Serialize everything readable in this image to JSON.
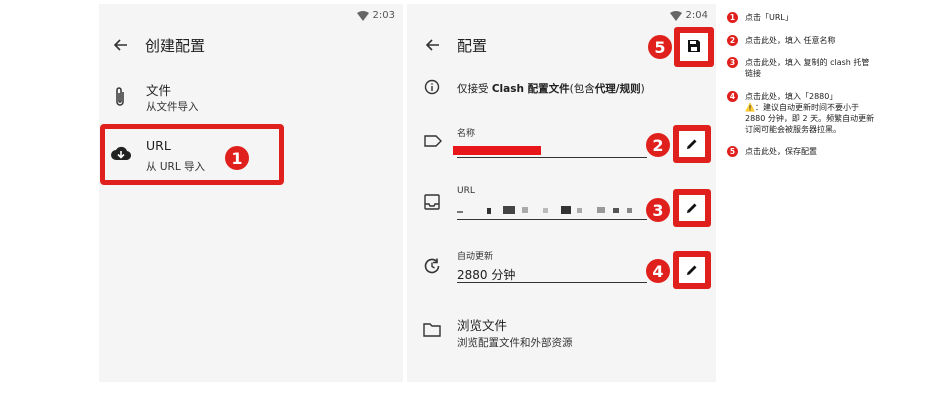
{
  "screen_left": {
    "status_time": "2:03",
    "title": "创建配置",
    "items": [
      {
        "title": "文件",
        "subtitle": "从文件导入"
      },
      {
        "title": "URL",
        "subtitle": "从 URL 导入"
      }
    ],
    "badge": "1"
  },
  "screen_right": {
    "status_time": "2:04",
    "title": "配置",
    "info_prefix": "仅接受 ",
    "info_bold1": "Clash 配置文件",
    "info_mid": "(包含",
    "info_bold2": "代理/规则",
    "info_suffix": ")",
    "fields": [
      {
        "label": "名称",
        "value": ""
      },
      {
        "label": "URL",
        "value": ""
      },
      {
        "label": "自动更新",
        "value": "2880 分钟"
      }
    ],
    "browse": {
      "title": "浏览文件",
      "subtitle": "浏览配置文件和外部资源"
    },
    "badges": [
      "2",
      "3",
      "4",
      "5"
    ]
  },
  "notes": [
    {
      "num": "1",
      "text": "点击「URL」"
    },
    {
      "num": "2",
      "text": "点击此处，填入 任意名称"
    },
    {
      "num": "3",
      "text": "点击此处，填入 复制的 clash 托管\n链接"
    },
    {
      "num": "4",
      "text": "点击此处，填入「2880」",
      "warn": "⚠️",
      "extra": "：建议自动更新时间不要小于\n2880 分钟，即 2 天。频繁自动更新\n订阅可能会被服务器拉黑。"
    },
    {
      "num": "5",
      "text": "点击此处，保存配置"
    }
  ],
  "colors": {
    "accent": "#e0201c",
    "screen_bg": "#f5f5f5"
  }
}
